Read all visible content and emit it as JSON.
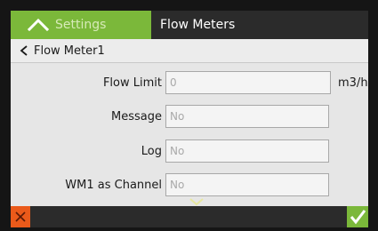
{
  "tabs": {
    "settings_label": "Settings",
    "flow_meters_label": "Flow Meters"
  },
  "breadcrumb": {
    "title": "Flow Meter1"
  },
  "form": {
    "flow_limit": {
      "label": "Flow Limit",
      "value": "0",
      "unit": "m3/h"
    },
    "message": {
      "label": "Message",
      "value": "No"
    },
    "log": {
      "label": "Log",
      "value": "No"
    },
    "wm1_channel": {
      "label": "WM1 as Channel",
      "value": "No"
    }
  },
  "icons": {
    "settings_chevron": "chevron-up-icon",
    "back": "chevron-left-icon",
    "scroll_down": "chevron-down-icon",
    "cancel": "close-icon",
    "confirm": "check-icon"
  },
  "colors": {
    "accent_green": "#7bb83a",
    "cancel_orange": "#ea5a1a",
    "bar_dark": "#2b2b2b",
    "screen_bg": "#e6e6e6"
  }
}
